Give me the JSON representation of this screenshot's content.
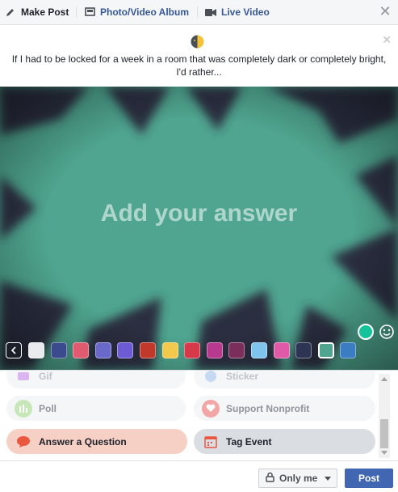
{
  "header": {
    "tabs": [
      {
        "label": "Make Post",
        "icon": "pencil-icon"
      },
      {
        "label": "Photo/Video Album",
        "icon": "album-icon"
      },
      {
        "label": "Live Video",
        "icon": "video-camera-icon"
      }
    ],
    "close_icon": "close-icon"
  },
  "prompt": {
    "icon": "half-moon-sun-icon",
    "text": "If I had to be locked for a week in a room that was completely dark or completely bright, I'd rather..."
  },
  "canvas": {
    "placeholder": "Add your answer",
    "background_colors": {
      "green": "#4fa58f",
      "dark": "#2b2f3f"
    },
    "swatches": [
      {
        "name": "white",
        "color": "#e9ebee"
      },
      {
        "name": "dots-navy",
        "color": "#3b4a8c"
      },
      {
        "name": "pink-pattern",
        "color": "#e05a70"
      },
      {
        "name": "blue-purple",
        "color": "#6a68c9"
      },
      {
        "name": "violet",
        "color": "#6d5bd6"
      },
      {
        "name": "red-brick",
        "color": "#c0392b"
      },
      {
        "name": "rainbow",
        "color": "#f2c94c"
      },
      {
        "name": "red-dots",
        "color": "#d63a4a"
      },
      {
        "name": "heart-magenta",
        "color": "#b83a8e"
      },
      {
        "name": "sunset",
        "color": "#7b2e59"
      },
      {
        "name": "light-blue",
        "color": "#7fc4ec"
      },
      {
        "name": "pink-flowers",
        "color": "#e15aa8"
      },
      {
        "name": "city-night",
        "color": "#2e3554"
      },
      {
        "name": "green-selected",
        "color": "#4fa58f"
      },
      {
        "name": "blue-gradient",
        "color": "#3b7cc2"
      }
    ]
  },
  "options": [
    {
      "label": "Gif",
      "icon": "gif-icon",
      "state": "faded"
    },
    {
      "label": "Sticker",
      "icon": "sticker-icon",
      "state": "faded"
    },
    {
      "label": "Poll",
      "icon": "poll-icon",
      "state": "normal"
    },
    {
      "label": "Support Nonprofit",
      "icon": "heart-icon",
      "state": "normal"
    },
    {
      "label": "Answer a Question",
      "icon": "speech-bubble-icon",
      "state": "active"
    },
    {
      "label": "Tag Event",
      "icon": "calendar-icon",
      "state": "hover"
    }
  ],
  "footer": {
    "privacy_label": "Only me",
    "post_label": "Post"
  },
  "colors": {
    "accent": "#4267b2",
    "link": "#365899",
    "active_option": "#f6cfc5"
  }
}
